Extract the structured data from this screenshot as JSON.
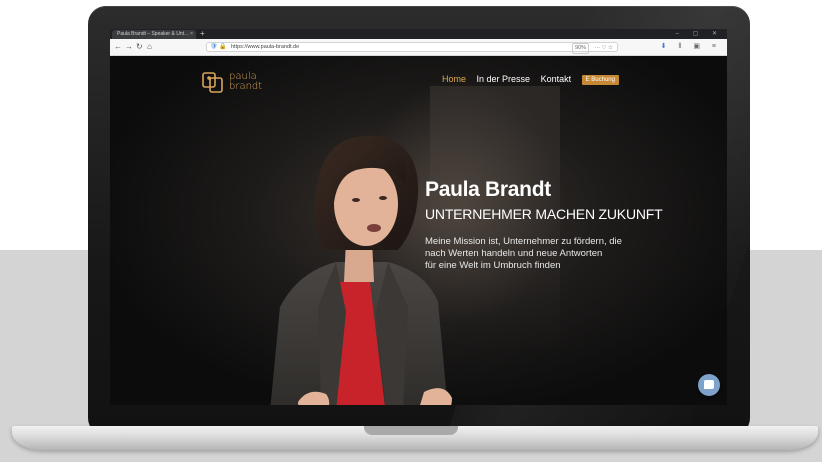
{
  "browser": {
    "tab_title": "Paula Brandt – Speaker & Unt…",
    "tab_close": "×",
    "new_tab": "+",
    "url": "https://www.paula-brandt.de",
    "zoom": "90%",
    "url_actions": "··· ♡ ☆",
    "window_controls": "–  ▢  ✕"
  },
  "site": {
    "logo_line1": "paula",
    "logo_line2": "brandt",
    "nav": {
      "home": "Home",
      "press": "In der Presse",
      "contact": "Kontakt",
      "booking": "E Buchung"
    },
    "hero": {
      "name": "Paula Brandt",
      "tagline": "UNTERNEHMER MACHEN ZUKUNFT",
      "mission_line1": "Meine Mission ist, Unternehmer zu fördern, die",
      "mission_line2": "nach Werten handeln und neue Antworten",
      "mission_line3": "für eine Welt im Umbruch finden"
    }
  },
  "colors": {
    "accent": "#d9a45a",
    "nav_active": "#e2a94b",
    "cta": "#c78836",
    "chat": "#7ea2c9"
  },
  "icons": {
    "back": "arrow-left-icon",
    "forward": "arrow-right-icon",
    "reload": "reload-icon",
    "home": "home-icon",
    "chat": "chat-icon"
  }
}
